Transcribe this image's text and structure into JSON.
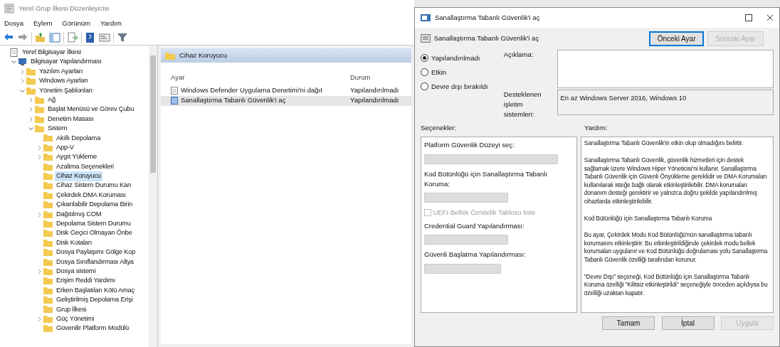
{
  "editor": {
    "title": "Yerel Grup İlkesi Düzenleyicisi",
    "menu": [
      "Dosya",
      "Eylem",
      "Görünüm",
      "Yardım"
    ],
    "tree": [
      {
        "label": "Yerel Bilgisayar İlkesi",
        "kind": "root",
        "selected": false,
        "children": [
          {
            "label": "Bilgisayar Yapılandırması",
            "kind": "computer",
            "expanded": true,
            "selected": false,
            "children": [
              {
                "label": "Yazılım Ayarları",
                "kind": "folder",
                "expanded": false,
                "selected": false
              },
              {
                "label": "Windows Ayarları",
                "kind": "folder",
                "expanded": false,
                "selected": false
              },
              {
                "label": "Yönetim Şablonları",
                "kind": "folder",
                "expanded": true,
                "selected": false,
                "children": [
                  {
                    "label": "Ağ",
                    "kind": "folder",
                    "expanded": false,
                    "selected": false
                  },
                  {
                    "label": "Başlat Menüsü ve Görev Çubu",
                    "kind": "folder",
                    "expanded": false,
                    "selected": false
                  },
                  {
                    "label": "Denetim Masası",
                    "kind": "folder",
                    "expanded": false,
                    "selected": false
                  },
                  {
                    "label": "Sistem",
                    "kind": "folder",
                    "expanded": true,
                    "selected": false,
                    "children": [
                      {
                        "label": "Akıllı Depolama",
                        "kind": "folder",
                        "selected": false
                      },
                      {
                        "label": "App-V",
                        "kind": "folder",
                        "expanded": false,
                        "selected": false
                      },
                      {
                        "label": "Aygıt Yükleme",
                        "kind": "folder",
                        "expanded": false,
                        "selected": false
                      },
                      {
                        "label": "Azaltma Seçenekleri",
                        "kind": "folder",
                        "selected": false
                      },
                      {
                        "label": "Cihaz Koruyucu",
                        "kind": "folder",
                        "selected": true
                      },
                      {
                        "label": "Cihaz Sistem Durumu Kan",
                        "kind": "folder",
                        "selected": false
                      },
                      {
                        "label": "Çekirdek DMA Koruması",
                        "kind": "folder",
                        "selected": false
                      },
                      {
                        "label": "Çıkarılabilir Depolama Birin",
                        "kind": "folder",
                        "selected": false
                      },
                      {
                        "label": "Dağıtılmış COM",
                        "kind": "folder",
                        "expanded": false,
                        "selected": false
                      },
                      {
                        "label": "Depolama Sistem Durumu",
                        "kind": "folder",
                        "selected": false
                      },
                      {
                        "label": "Disk Geçici Olmayan Önbe",
                        "kind": "folder",
                        "selected": false
                      },
                      {
                        "label": "Disk Kotaları",
                        "kind": "folder",
                        "selected": false
                      },
                      {
                        "label": "Dosya Paylaşımı Gölge Kop",
                        "kind": "folder",
                        "selected": false
                      },
                      {
                        "label": "Dosya Sınıflandırması Altya",
                        "kind": "folder",
                        "selected": false
                      },
                      {
                        "label": "Dosya sistemi",
                        "kind": "folder",
                        "expanded": false,
                        "selected": false
                      },
                      {
                        "label": "Erişim Reddi Yardımı",
                        "kind": "folder",
                        "selected": false
                      },
                      {
                        "label": "Erken Başlatılan Kötü Amaç",
                        "kind": "folder",
                        "selected": false
                      },
                      {
                        "label": "Geliştirilmiş Depolama Erişi",
                        "kind": "folder",
                        "selected": false
                      },
                      {
                        "label": "Grup İlkesi",
                        "kind": "folder",
                        "selected": false
                      },
                      {
                        "label": "Güç Yönetimi",
                        "kind": "folder",
                        "expanded": false,
                        "selected": false
                      },
                      {
                        "label": "Güvenilir Platform Modülü",
                        "kind": "folder",
                        "selected": false
                      }
                    ]
                  }
                ]
              }
            ]
          }
        ]
      }
    ],
    "panel": {
      "heading": "Cihaz Koruyucu",
      "columns": [
        "Ayar",
        "Durum"
      ],
      "rows": [
        {
          "setting": "Windows Defender Uygulama Denetimi'ni dağıt",
          "state": "Yapılandırılmadı",
          "selected": false
        },
        {
          "setting": "Sanallaştırma Tabanlı Güvenlik'i aç",
          "state": "Yapılandırılmadı",
          "selected": true
        }
      ]
    }
  },
  "dialog": {
    "title": "Sanallaştırma Tabanlı Güvenlik'i aç",
    "heading": "Sanallaştırma Tabanlı Güvenlik'i aç",
    "nav_buttons": [
      {
        "label": "Önceki Ayar",
        "disabled": false
      },
      {
        "label": "Sonraki Ayar",
        "disabled": true
      }
    ],
    "radios": [
      {
        "label": "Yapılandırılmadı",
        "selected": true
      },
      {
        "label": "Etkin",
        "selected": false
      },
      {
        "label": "Devre dışı bırakıldı",
        "selected": false
      }
    ],
    "comment_label": "Açıklama:",
    "supported_label": "Desteklenen işletim sistemleri:",
    "supported_value": "En az Windows Server 2016, Windows 10",
    "options_label": "Seçenekler:",
    "help_label": "Yardım:",
    "options": [
      {
        "kind": "select",
        "label": "Platform Güvenlik Düzeyi seç:"
      },
      {
        "kind": "select",
        "label": "Kod Bütünlüğü için Sanallaştırma Tabanlı Koruma:"
      },
      {
        "kind": "checkbox",
        "label": "UEFI Bellek Öznitelik Tablosu liste",
        "checked": false
      },
      {
        "kind": "select",
        "label": "Credential Guard Yapılandırması:"
      },
      {
        "kind": "select",
        "label": "Güvenli Başlatma Yapılandırması:"
      }
    ],
    "help": [
      "Sanallaştırma Tabanlı Güvenlik'in etkin olup olmadığını belirtir.",
      "Sanallaştırma Tabanlı Güvenlik, güvenlik hizmetleri için destek sağlamak üzere Windows Hiper Yöneticisi'ni kullanır. Sanallaştırma Tabanlı Güvenlik için Güvenli Önyükleme gereklidir ve DMA Korumaları kullanılarak isteğe bağlı olarak etkinleştirilebilir. DMA korumaları donanım desteği gerektirir ve yalnızca doğru şekilde yapılandırılmış cihazlarda etkinleştirilebilir.",
      "Kod Bütünlüğü için Sanallaştırma Tabanlı Koruma",
      "Bu ayar, Çekirdek Modu Kod Bütünlüğü'nün sanallaştırma tabanlı korumasını etkinleştirir. Bu etkinleştirildiğinde çekirdek modu bellek korumaları uygulanır ve Kod Bütünlüğü doğrulaması yolu Sanallaştırma Tabanlı Güvenlik özelliği tarafından korunur.",
      "\"Devre Dışı\" seçeneği, Kod Bütünlüğü için Sanallaştırma Tabanlı Koruma özelliği \"Kilitsiz etkinleştirildi\" seçeneğiyle önceden açıldıysa bu özelliği uzaktan kapatır."
    ],
    "buttons": [
      {
        "label": "Tamam",
        "disabled": false
      },
      {
        "label": "İptal",
        "disabled": false
      },
      {
        "label": "Uygula",
        "disabled": true
      }
    ]
  }
}
